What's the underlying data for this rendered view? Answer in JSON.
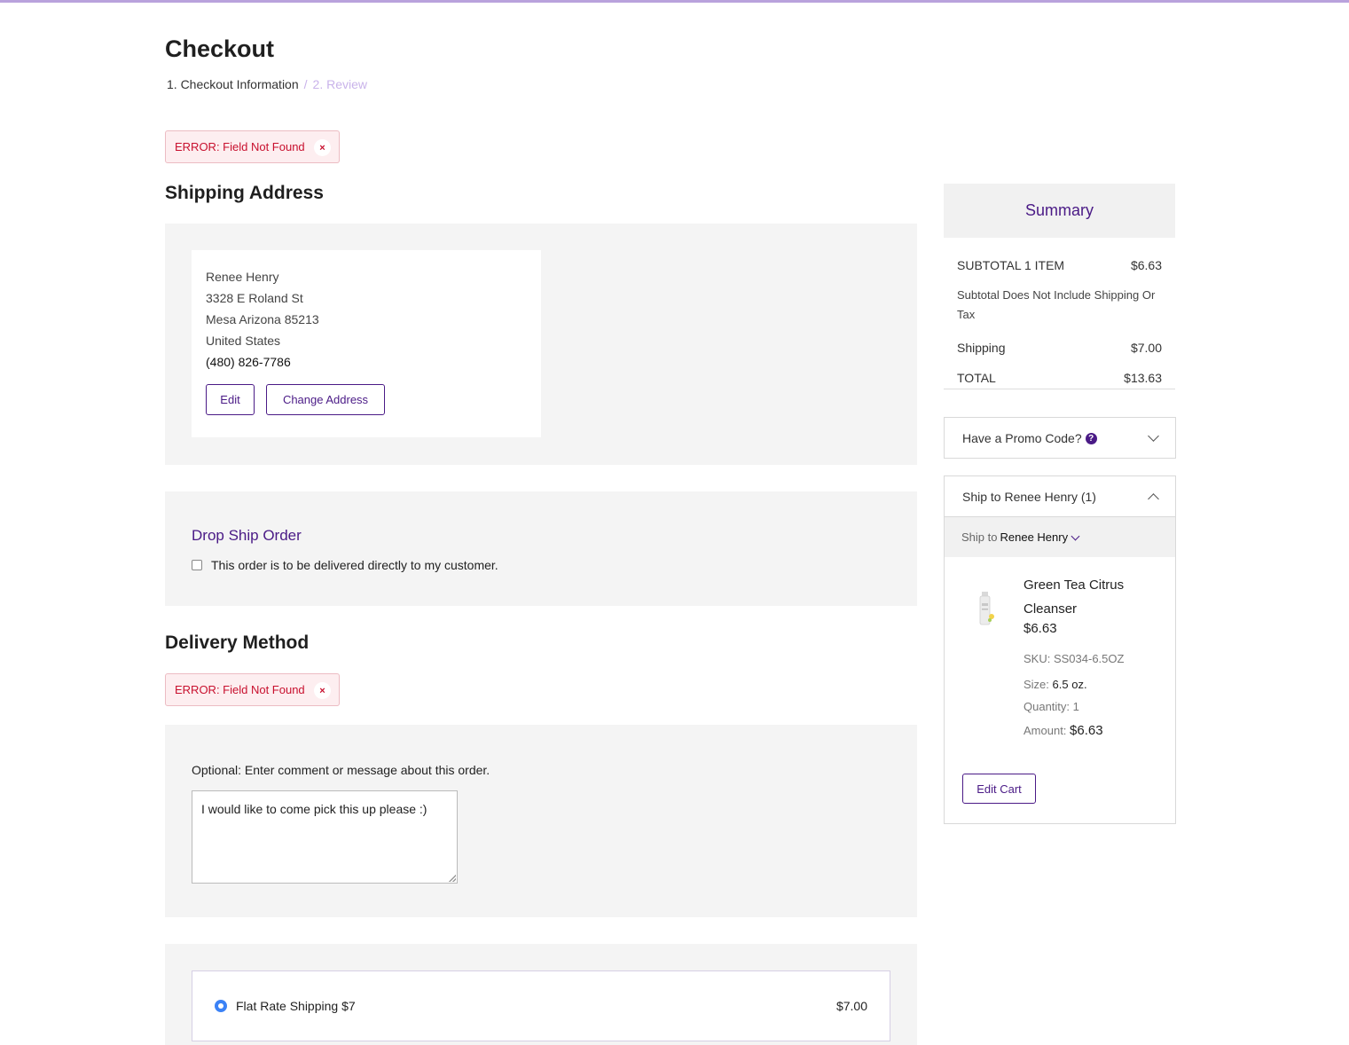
{
  "page": {
    "title": "Checkout"
  },
  "breadcrumb": {
    "step1": "1. Checkout Information",
    "separator": "/",
    "step2": "2. Review"
  },
  "errors": {
    "top": "ERROR: Field Not Found",
    "delivery": "ERROR: Field Not Found",
    "close_glyph": "×"
  },
  "shipping_address": {
    "heading": "Shipping Address",
    "name": "Renee Henry",
    "street": "3328 E Roland St",
    "city_state_zip": "Mesa Arizona 85213",
    "country": "United States",
    "phone": "(480) 826-7786",
    "edit_label": "Edit",
    "change_label": "Change Address"
  },
  "drop_ship": {
    "title": "Drop Ship Order",
    "checkbox_label": "This order is to be delivered directly to my customer.",
    "checked": false
  },
  "delivery": {
    "heading": "Delivery Method",
    "comment_label": "Optional: Enter comment or message about this order.",
    "comment_value": "I would like to come pick this up please :)",
    "option_label": "Flat Rate Shipping $7",
    "option_price": "$7.00",
    "selected": true
  },
  "summary": {
    "title": "Summary",
    "subtotal_label": "SUBTOTAL 1 ITEM",
    "subtotal_value": "$6.63",
    "note": "Subtotal Does Not Include Shipping Or Tax",
    "shipping_label": "Shipping",
    "shipping_value": "$7.00",
    "total_label": "TOTAL",
    "total_value": "$13.63"
  },
  "promo": {
    "label": "Have a Promo Code?",
    "help_glyph": "?"
  },
  "ship_to": {
    "header": "Ship to Renee Henry (1)",
    "bar_label": "Ship to",
    "bar_name": "Renee Henry"
  },
  "product": {
    "name": "Green Tea Citrus Cleanser",
    "price": "$6.63",
    "sku": "SKU: SS034-6.5OZ",
    "size_label": "Size:",
    "size_value": "6.5 oz.",
    "quantity": "Quantity: 1",
    "amount_label": "Amount:",
    "amount_value": "$6.63",
    "image_icon": "product-bottle-image"
  },
  "edit_cart_label": "Edit Cart",
  "colors": {
    "brand": "#4a1a86",
    "error": "#c8102e",
    "radio": "#3b82f6",
    "panel": "#f4f4f4"
  }
}
